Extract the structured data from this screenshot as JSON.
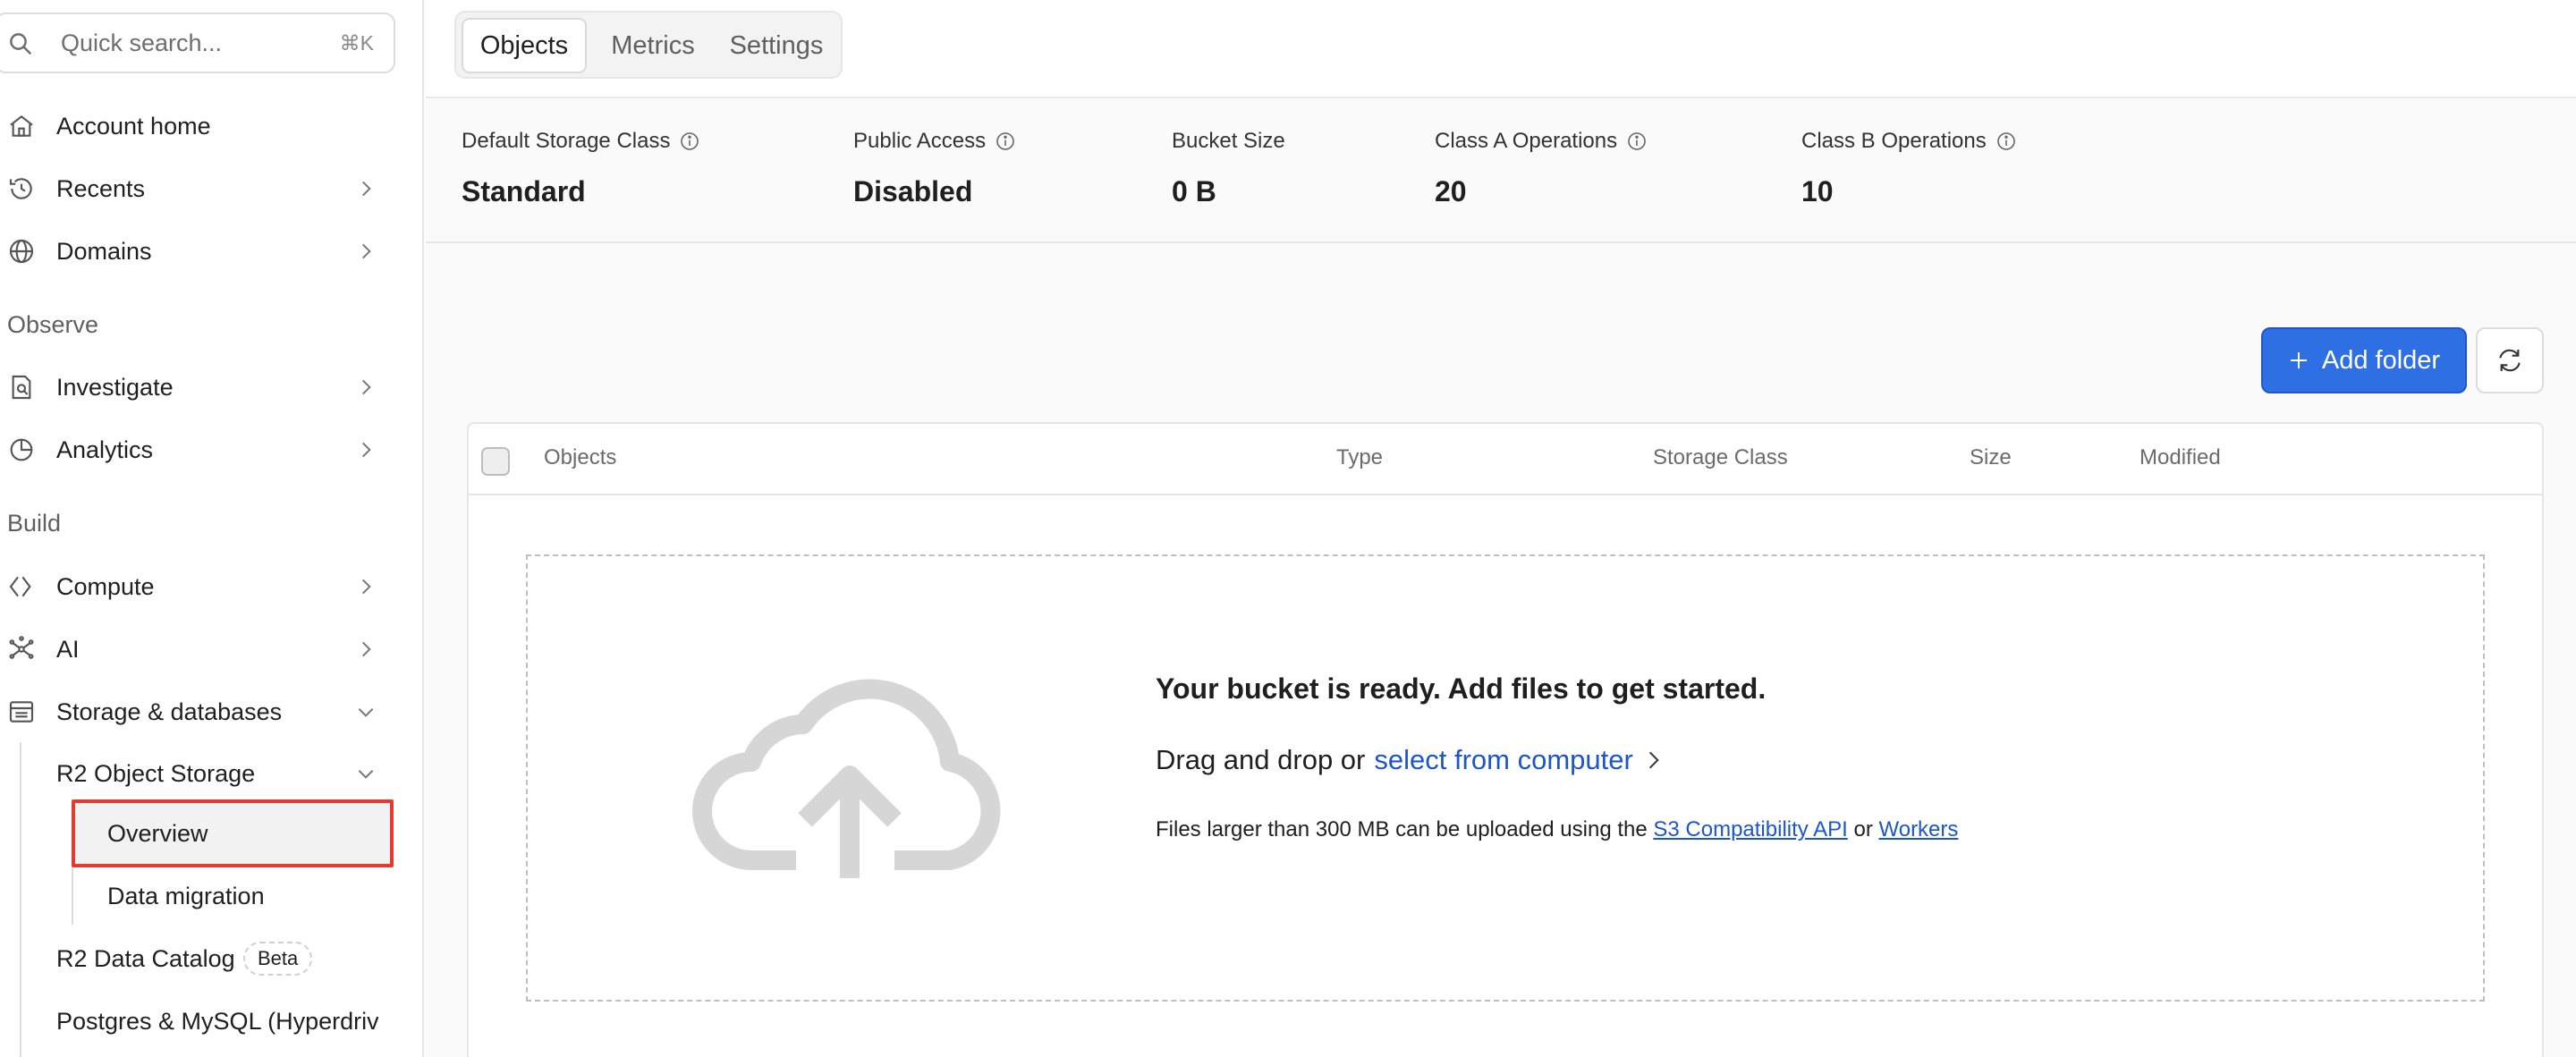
{
  "search": {
    "placeholder": "Quick search...",
    "shortcut": "⌘K"
  },
  "sidebar": {
    "items": [
      {
        "label": "Account home",
        "icon": "home-icon"
      },
      {
        "label": "Recents",
        "icon": "history-icon"
      },
      {
        "label": "Domains",
        "icon": "globe-icon"
      }
    ],
    "observe_label": "Observe",
    "observe_items": [
      {
        "label": "Investigate",
        "icon": "investigate-icon"
      },
      {
        "label": "Analytics",
        "icon": "analytics-icon"
      }
    ],
    "build_label": "Build",
    "build_items": [
      {
        "label": "Compute",
        "icon": "compute-icon"
      },
      {
        "label": "AI",
        "icon": "ai-icon"
      },
      {
        "label": "Storage & databases",
        "icon": "storage-icon"
      }
    ],
    "r2_label": "R2 Object Storage",
    "r2_sub": {
      "overview": "Overview",
      "migration": "Data migration"
    },
    "catalog_label": "R2 Data Catalog",
    "catalog_badge": "Beta",
    "postgres_label": "Postgres & MySQL (Hyperdriv"
  },
  "tabs": {
    "objects": "Objects",
    "metrics": "Metrics",
    "settings": "Settings"
  },
  "stats": [
    {
      "label": "Default Storage Class",
      "value": "Standard"
    },
    {
      "label": "Public Access",
      "value": "Disabled"
    },
    {
      "label": "Bucket Size",
      "value": "0 B"
    },
    {
      "label": "Class A Operations",
      "value": "20"
    },
    {
      "label": "Class B Operations",
      "value": "10"
    }
  ],
  "actions": {
    "add_folder": "Add folder"
  },
  "table": {
    "columns": {
      "objects": "Objects",
      "type": "Type",
      "storage_class": "Storage Class",
      "size": "Size",
      "modified": "Modified"
    }
  },
  "empty": {
    "title": "Your bucket is ready. Add files to get started.",
    "drag_text": "Drag and drop or",
    "select_link": "select from computer",
    "note_prefix": "Files larger than 300 MB can be uploaded using the",
    "s3_link": "S3 Compatibility API",
    "or": "or",
    "workers_link": "Workers"
  },
  "colors": {
    "accent": "#2f6fe4",
    "link": "#1d56c9",
    "highlight_border": "#e23b30"
  }
}
